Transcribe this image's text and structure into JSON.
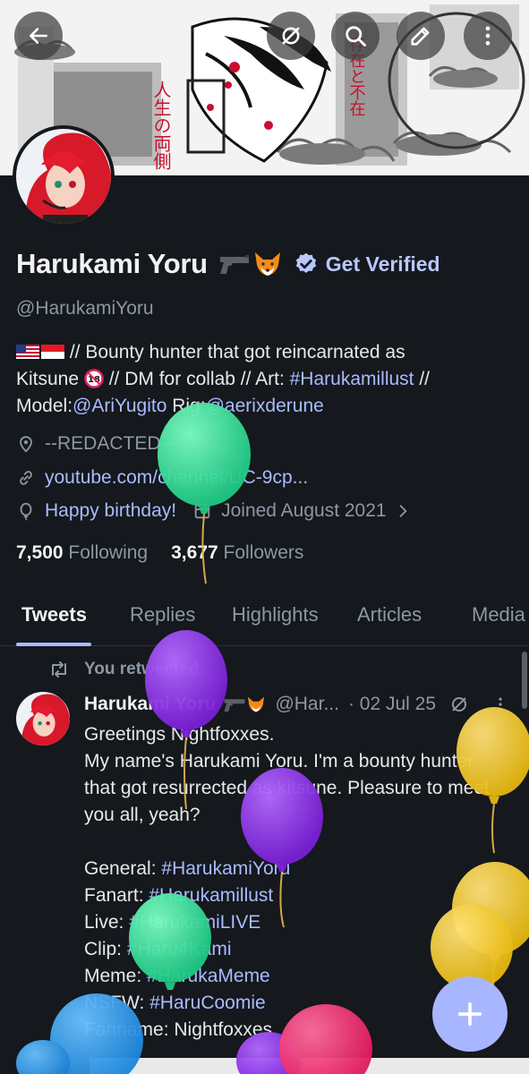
{
  "banner": {
    "vertical_text_left": "人生の両側",
    "vertical_text_right": "存在と不在"
  },
  "top_bar": {
    "back_icon": "arrow-left-icon",
    "refresh_icon": "refresh-slash-icon",
    "search_icon": "search-icon",
    "edit_icon": "pencil-icon",
    "more_icon": "more-vertical-icon"
  },
  "profile": {
    "name": "Harukami Yoru",
    "name_emojis": [
      "pistol",
      "fox"
    ],
    "get_verified": "Get Verified",
    "handle": "@HarukamiYoru",
    "bio": {
      "flags": [
        "us-flag",
        "indonesia-flag"
      ],
      "line1_text": " // Bounty hunter that got reincarnated as",
      "line2_a": "Kitsune ",
      "line2_b": " // DM for collab // Art: ",
      "line2_link": "#Harukamillust",
      "line2_c": " //",
      "line3_a": "Model:",
      "line3_link1": "@AriYugito",
      "line3_b": " Rig:",
      "line3_link2": "@aerixderune"
    },
    "location": "--REDACTED--",
    "website": "youtube.com/channel/UC-9cp...",
    "birthday": "Happy birthday!",
    "joined": "Joined August 2021",
    "following_count": "7,500",
    "following_label": "Following",
    "followers_count": "3,677",
    "followers_label": "Followers"
  },
  "tabs": [
    {
      "label": "Tweets",
      "active": true
    },
    {
      "label": "Replies",
      "active": false
    },
    {
      "label": "Highlights",
      "active": false
    },
    {
      "label": "Articles",
      "active": false
    },
    {
      "label": "Media",
      "active": false
    }
  ],
  "tweet": {
    "retweet_label": "You retweeted",
    "author_name": "Harukami Yoru",
    "author_handle": "@Har...",
    "date": "· 02 Jul 25",
    "lines": {
      "l1": "Greetings Nightfoxxes.",
      "l2": "My name's Harukami Yoru. I'm a bounty hunter",
      "l3": "that got resurrected as kitsune. Pleasure to meet",
      "l4": "you all, yeah?",
      "general_label": "General: ",
      "general_tag": "#HarukamiYoru",
      "fanart_label": "Fanart: ",
      "fanart_tag": "#Harukamillust",
      "live_label": "Live: ",
      "live_tag": "#HarukamiLIVE",
      "clip_label": "Clip: ",
      "clip_tag": "#Haru4Kami",
      "meme_label": "Meme: ",
      "meme_tag": "#HarukaMeme",
      "nsfw_label": "NSFW: ",
      "nsfw_tag": "#HaruCoomie",
      "fanname_label": "Fanname: ",
      "fanname_value": "Nightfoxxes"
    }
  },
  "fab": {
    "icon": "plus-icon"
  },
  "colors": {
    "background": "#15181d",
    "link": "#a9bcff",
    "muted": "#8b98a5",
    "fab": "#a8b6ff",
    "balloon_green": "#2fe39a",
    "balloon_purple": "#8a2be2",
    "balloon_yellow": "#f0c419",
    "balloon_blue": "#2f9bea",
    "balloon_pink": "#ec2c6d"
  }
}
